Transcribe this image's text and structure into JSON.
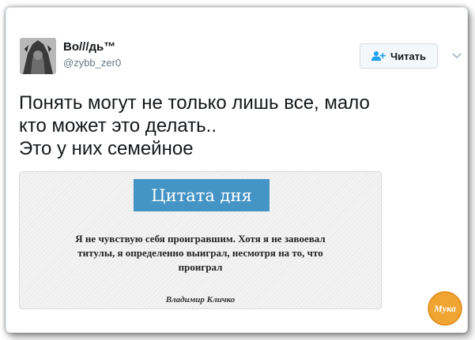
{
  "tweet": {
    "display_name": "Во///дь™",
    "handle": "@zybb_zer0",
    "follow_label": "Читать",
    "text_lines": [
      "Понять могут не только лишь все, мало",
      "кто может это делать..",
      "Это у них семейное"
    ]
  },
  "media": {
    "title": "Цитата дня",
    "quote_lines": [
      "Я не чувствую себя проигравшим. Хотя я не завоевал",
      "титулы, я определенно выиграл, несмотря на то, что",
      "проиграл"
    ],
    "author": "Владимир Кличко"
  },
  "watermark": {
    "text": "Мука"
  },
  "icons": {
    "follow": "add-person-icon",
    "menu": "chevron-down-icon"
  },
  "colors": {
    "accent": "#1da1f2",
    "quote_title_bg": "#4594c6",
    "logo_orange": "#f0a533"
  }
}
